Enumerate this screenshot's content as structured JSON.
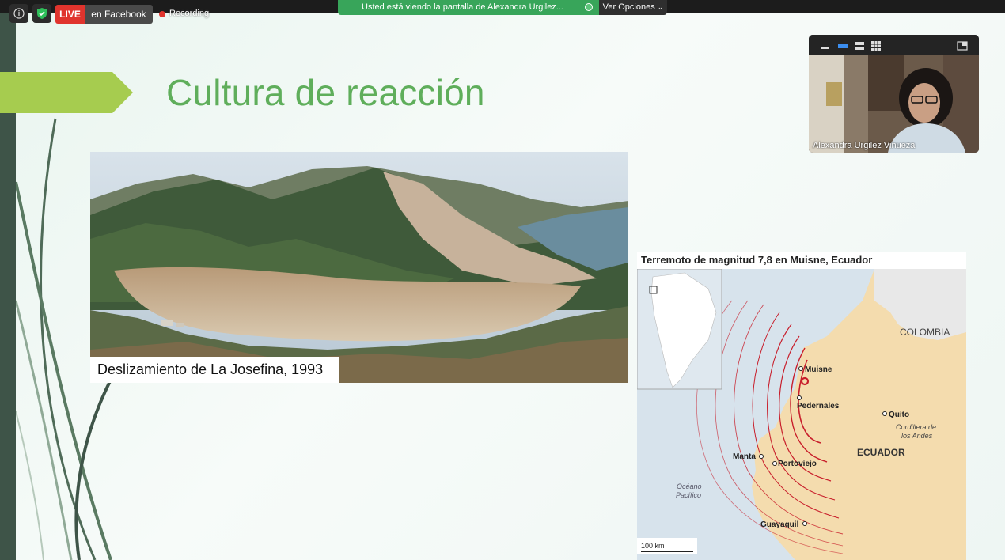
{
  "zoom_bar": {
    "live_label": "LIVE",
    "live_target": "en Facebook",
    "recording_label": "Recording",
    "share_banner": "Usted está viendo la pantalla de Alexandra Urgilez...",
    "options_label": "Ver Opciones"
  },
  "slide": {
    "title": "Cultura de reacción",
    "photo_caption": "Deslizamiento de La Josefina, 1993"
  },
  "map": {
    "title": "Terremoto de magnitud 7,8 en Muisne, Ecuador",
    "labels": {
      "colombia": "COLOMBIA",
      "ecuador": "ECUADOR",
      "muisne": "Muisne",
      "pedernales": "Pedernales",
      "quito": "Quito",
      "cordillera": "Cordillera de",
      "andes": "los Andes",
      "manta": "Manta",
      "portoviejo": "Portoviejo",
      "oceano": "Océano",
      "pacifico": "Pacífico",
      "guayaquil": "Guayaquil",
      "scale": "100 km"
    }
  },
  "video": {
    "participant_name": "Alexandra Urgilez Vinueza"
  },
  "colors": {
    "title_green": "#5fae5b",
    "arrow_green": "#a6cc4f",
    "live_red": "#e0342d",
    "banner_green": "#38a55a",
    "sea": "#d7e3ec",
    "land": "#f4dcae",
    "contour": "#c81e2b"
  }
}
